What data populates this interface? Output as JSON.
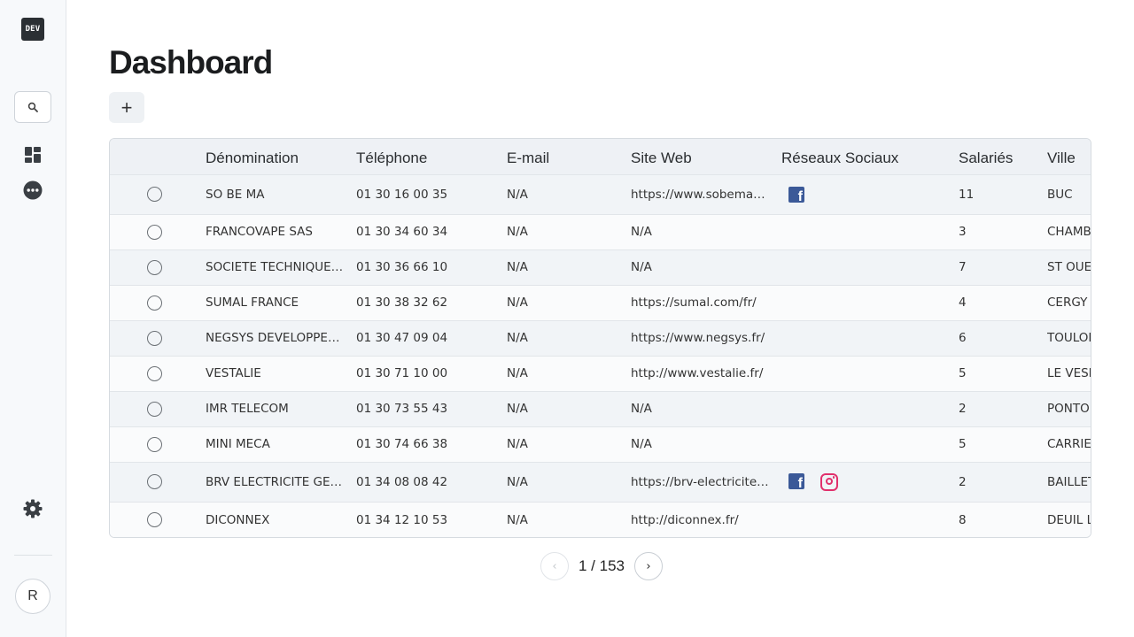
{
  "sidebar": {
    "logo": "DEV",
    "avatar": "R"
  },
  "page": {
    "title": "Dashboard",
    "add_label": "+"
  },
  "table": {
    "columns": [
      "",
      "Dénomination",
      "Téléphone",
      "E-mail",
      "Site Web",
      "Réseaux Sociaux",
      "Salariés",
      "Ville"
    ],
    "rows": [
      {
        "name": "SO BE MA",
        "phone": "01 30 16 00 35",
        "email": "N/A",
        "site": "https://www.sobemafr.com/",
        "social": [
          "facebook"
        ],
        "employees": "11",
        "city": "BUC"
      },
      {
        "name": "FRANCOVAPE SAS",
        "phone": "01 30 34 60 34",
        "email": "N/A",
        "site": "N/A",
        "social": [],
        "employees": "3",
        "city": "CHAMBOURCY"
      },
      {
        "name": "SOCIETE TECHNIQUE D'EQUIPEMENT",
        "phone": "01 30 36 66 10",
        "email": "N/A",
        "site": "N/A",
        "social": [],
        "employees": "7",
        "city": "ST OUEN L'AUMONE"
      },
      {
        "name": "SUMAL FRANCE",
        "phone": "01 30 38 32 62",
        "email": "N/A",
        "site": "https://sumal.com/fr/",
        "social": [],
        "employees": "4",
        "city": "CERGY"
      },
      {
        "name": "NEGSYS DEVELOPPEMENT",
        "phone": "01 30 47 09 04",
        "email": "N/A",
        "site": "https://www.negsys.fr/",
        "social": [],
        "employees": "6",
        "city": "TOULON"
      },
      {
        "name": "VESTALIE",
        "phone": "01 30 71 10 00",
        "email": "N/A",
        "site": "http://www.vestalie.fr/",
        "social": [],
        "employees": "5",
        "city": "LE VESINET"
      },
      {
        "name": "IMR TELECOM",
        "phone": "01 30 73 55 43",
        "email": "N/A",
        "site": "N/A",
        "social": [],
        "employees": "2",
        "city": "PONTOISE"
      },
      {
        "name": "MINI MECA",
        "phone": "01 30 74 66 38",
        "email": "N/A",
        "site": "N/A",
        "social": [],
        "employees": "5",
        "city": "CARRIERES"
      },
      {
        "name": "BRV ELECTRICITE GENERALE",
        "phone": "01 34 08 08 42",
        "email": "N/A",
        "site": "https://brv-electricite.fr/",
        "social": [
          "facebook",
          "instagram"
        ],
        "employees": "2",
        "city": "BAILLET"
      },
      {
        "name": "DICONNEX",
        "phone": "01 34 12 10 53",
        "email": "N/A",
        "site": "http://diconnex.fr/",
        "social": [],
        "employees": "8",
        "city": "DEUIL LA BARRE"
      }
    ]
  },
  "pagination": {
    "label": "1 / 153",
    "prev": "‹",
    "next": "›"
  }
}
